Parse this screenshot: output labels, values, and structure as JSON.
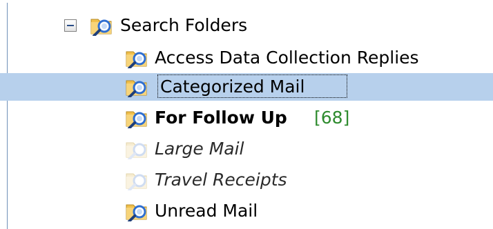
{
  "tree": {
    "root": {
      "label": "Search Folders",
      "expanded": true,
      "icon": "search-folder-icon"
    },
    "items": [
      {
        "label": "Access Data Collection Replies",
        "state": "normal"
      },
      {
        "label": "Categorized Mail",
        "state": "selected"
      },
      {
        "label": "For Follow Up",
        "state": "bold",
        "count": "[68]"
      },
      {
        "label": "Large Mail",
        "state": "disabled"
      },
      {
        "label": "Travel Receipts",
        "state": "disabled"
      },
      {
        "label": "Unread Mail",
        "state": "normal"
      }
    ]
  },
  "colors": {
    "selection": "#b7d0ec",
    "count": "#2e8b2e",
    "folder": "#f2c14e",
    "magnifier": "#2f6fd1"
  }
}
